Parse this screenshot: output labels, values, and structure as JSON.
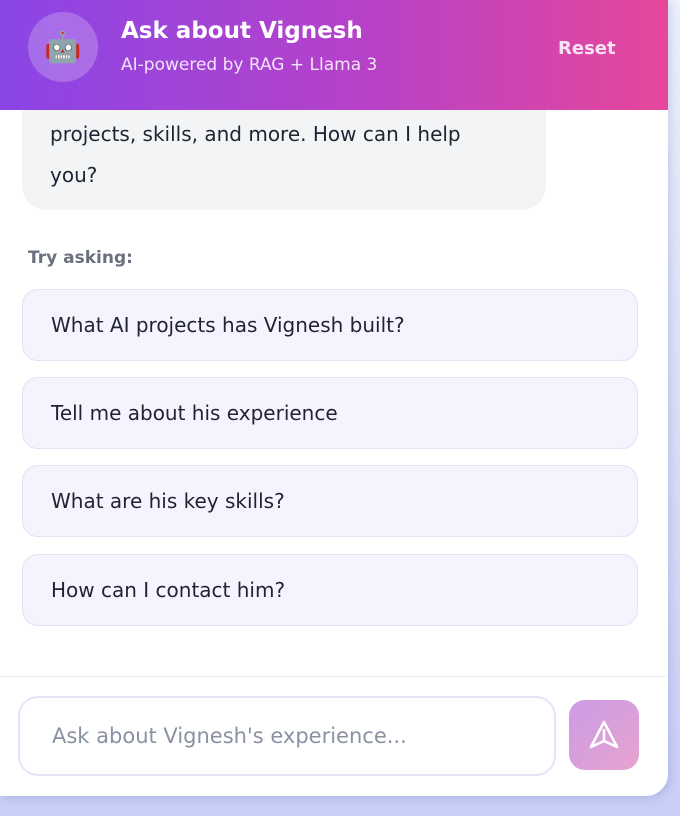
{
  "header": {
    "avatar_icon": "🤖",
    "title": "Ask about Vignesh",
    "subtitle": "AI-powered by RAG + Llama 3",
    "reset_label": "Reset"
  },
  "messages": {
    "bot_line1": "projects, skills, and more. How can I help",
    "bot_line2": "you?"
  },
  "suggestions": {
    "heading": "Try asking:",
    "items": [
      "What AI projects has Vignesh built?",
      "Tell me about his experience",
      "What are his key skills?",
      "How can I contact him?"
    ]
  },
  "composer": {
    "placeholder": "Ask about Vignesh's experience...",
    "send_icon": "send-icon"
  },
  "colors": {
    "header_start": "#8a45e6",
    "header_end": "#e6479a",
    "suggestion_bg": "#f6f3fe"
  }
}
